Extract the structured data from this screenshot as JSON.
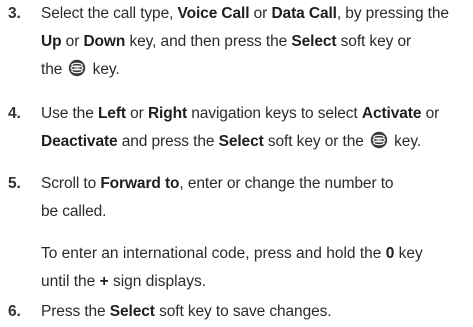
{
  "steps": {
    "s3": {
      "number": "3.",
      "l1_a": "Select the call type, ",
      "l1_b": "Voice Call",
      "l1_c": " or ",
      "l1_d": "Data Call",
      "l1_e": ", by pressing the",
      "l2_a": "Up",
      "l2_b": " or ",
      "l2_c": "Down",
      "l2_d": " key, and then press the ",
      "l2_e": "Select",
      "l2_f": " soft key or",
      "l3_a": "the ",
      "l3_b": " key."
    },
    "s4": {
      "number": "4.",
      "l1_a": "Use the ",
      "l1_b": "Left",
      "l1_c": " or ",
      "l1_d": "Right",
      "l1_e": " navigation keys to select ",
      "l1_f": "Activate",
      "l1_g": " or",
      "l2_a": "Deactivate",
      "l2_b": " and press the ",
      "l2_c": "Select",
      "l2_d": " soft key or the ",
      "l2_e": " key."
    },
    "s5": {
      "number": "5.",
      "l1_a": "Scroll to ",
      "l1_b": "Forward to",
      "l1_c": ", enter or change the number to",
      "l2": "be called.",
      "note_l1_a": "To enter an international code, press and hold the ",
      "note_l1_b": "0",
      "note_l1_c": " key",
      "note_l2_a": "until the ",
      "note_l2_b": "+",
      "note_l2_c": " sign displays."
    },
    "s6": {
      "number": "6.",
      "l1_a": "Press the ",
      "l1_b": "Select",
      "l1_c": " soft key to save changes."
    }
  },
  "icons": {
    "select_key": "select-key-icon"
  },
  "colors": {
    "text": "#2b2b2b",
    "icon": "#3a3a3a"
  }
}
